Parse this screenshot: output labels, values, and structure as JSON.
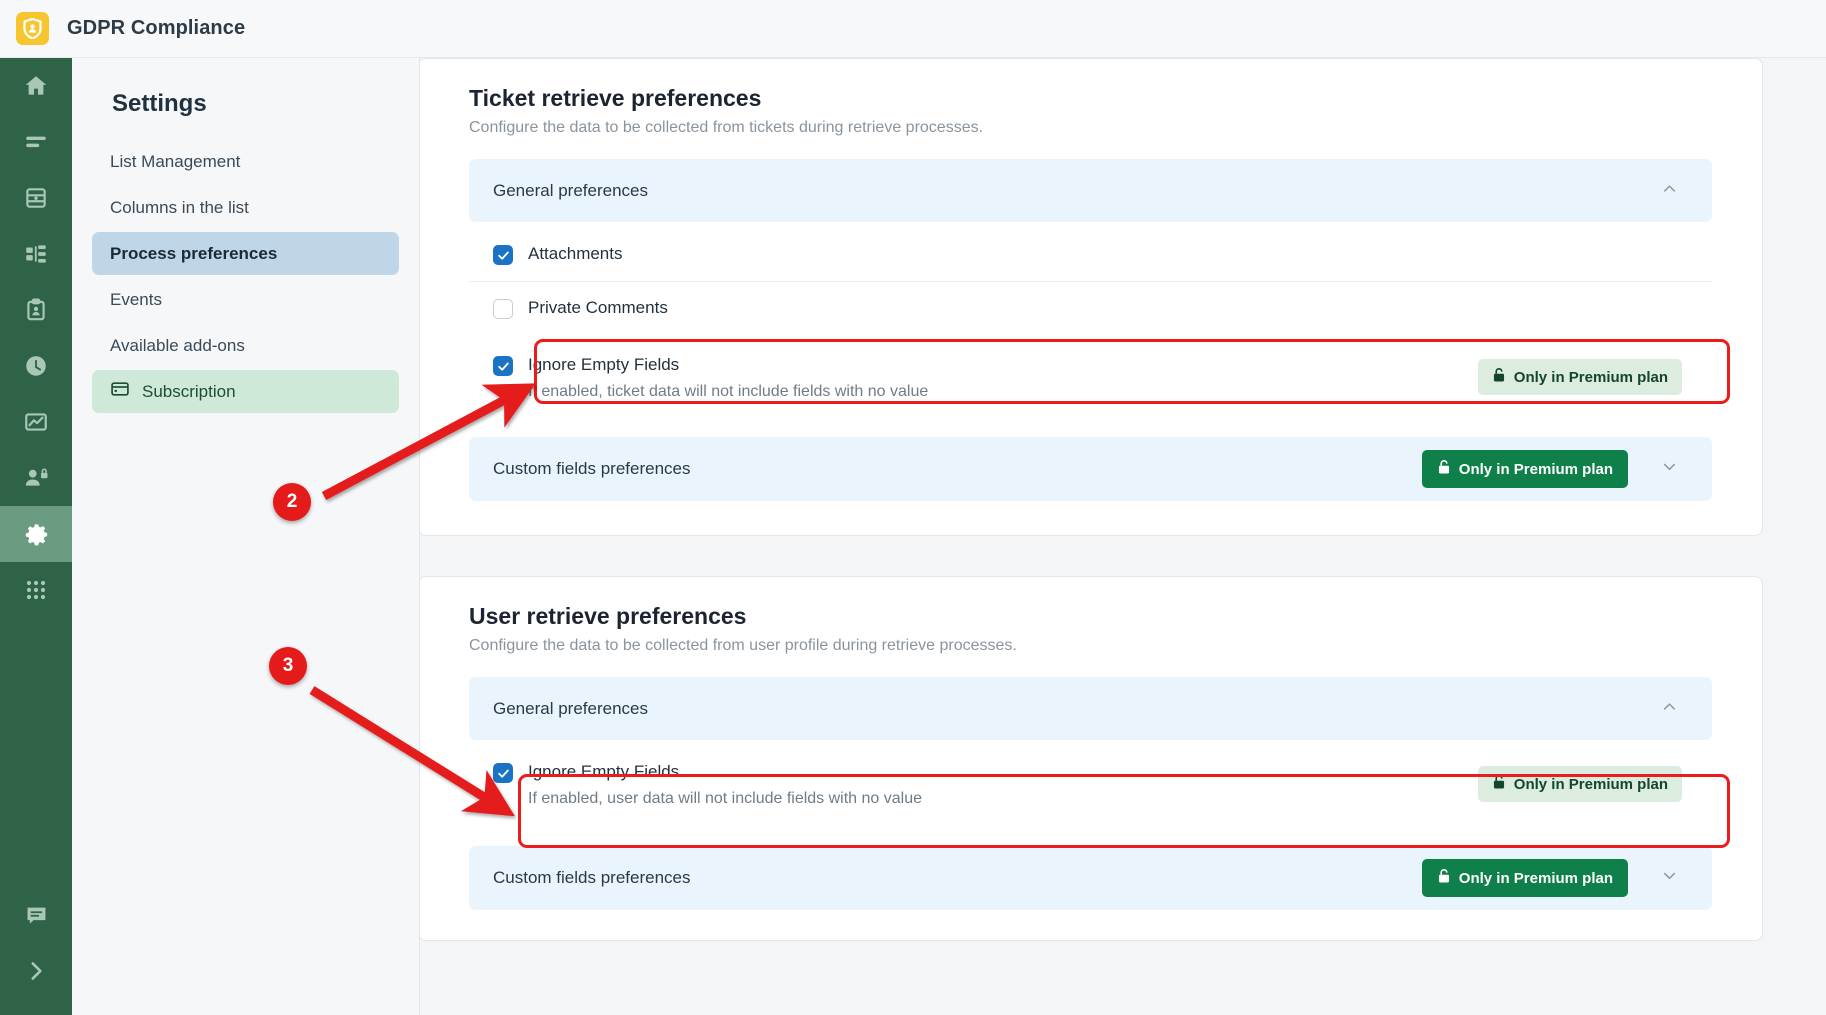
{
  "window": {
    "app_title": "GDPR Compliance",
    "logo_icon": "shield-user-icon"
  },
  "rail": {
    "items": [
      {
        "icon": "home-icon",
        "name": "home",
        "active": false
      },
      {
        "icon": "list-icon",
        "name": "lists",
        "active": false
      },
      {
        "icon": "database-icon",
        "name": "database",
        "active": false
      },
      {
        "icon": "org-chart-icon",
        "name": "organization",
        "active": false
      },
      {
        "icon": "clipboard-user-icon",
        "name": "requests",
        "active": false
      },
      {
        "icon": "clock-icon",
        "name": "history",
        "active": false
      },
      {
        "icon": "chart-line-icon",
        "name": "reports",
        "active": false
      },
      {
        "icon": "user-lock-icon",
        "name": "privacy",
        "active": false
      },
      {
        "icon": "gear-icon",
        "name": "settings",
        "active": true
      },
      {
        "icon": "grid-apps-icon",
        "name": "apps",
        "active": false
      }
    ],
    "bottom_items": [
      {
        "icon": "comment-icon",
        "name": "support-chat"
      },
      {
        "icon": "chevron-right-icon",
        "name": "expand-rail"
      }
    ]
  },
  "sidebar": {
    "title": "Settings",
    "items": [
      {
        "label": "List Management",
        "active": false,
        "icon": null
      },
      {
        "label": "Columns in the list",
        "active": false,
        "icon": null
      },
      {
        "label": "Process preferences",
        "active": true,
        "icon": null
      },
      {
        "label": "Events",
        "active": false,
        "icon": null
      },
      {
        "label": "Available add-ons",
        "active": false,
        "icon": null
      },
      {
        "label": "Subscription",
        "active": false,
        "icon": "credit-card-icon"
      }
    ]
  },
  "ticket_section": {
    "title": "Ticket retrieve preferences",
    "subtitle": "Configure the data to be collected from tickets during retrieve processes.",
    "general": {
      "label": "General preferences",
      "chevron": "chevron-up-icon",
      "rows": [
        {
          "label": "Attachments",
          "checked": true,
          "desc": null,
          "badge": null
        },
        {
          "label": "Private Comments",
          "checked": false,
          "desc": null,
          "badge": null
        },
        {
          "label": "Ignore Empty Fields",
          "checked": true,
          "desc": "If enabled, ticket data will not include fields with no value",
          "badge": "Only in Premium plan",
          "badge_style": "soft",
          "badge_icon": "unlock-icon"
        }
      ]
    },
    "custom_fields": {
      "label": "Custom fields preferences",
      "badge": "Only in Premium plan",
      "badge_style": "solid",
      "badge_icon": "unlock-icon",
      "chevron": "chevron-down-icon"
    }
  },
  "user_section": {
    "title": "User retrieve preferences",
    "subtitle": "Configure the data to be collected from user profile during retrieve processes.",
    "general": {
      "label": "General preferences",
      "chevron": "chevron-up-icon",
      "rows": [
        {
          "label": "Ignore Empty Fields",
          "checked": true,
          "desc": "If enabled, user data will not include fields with no value",
          "badge": "Only in Premium plan",
          "badge_style": "soft",
          "badge_icon": "unlock-icon"
        }
      ]
    },
    "custom_fields": {
      "label": "Custom fields preferences",
      "badge": "Only in Premium plan",
      "badge_style": "solid",
      "badge_icon": "unlock-icon",
      "chevron": "chevron-down-icon"
    }
  },
  "annotations": {
    "markers": [
      {
        "number": "2",
        "target": "ticket-ignore-empty-fields-row"
      },
      {
        "number": "3",
        "target": "user-ignore-empty-fields-row"
      }
    ],
    "highlight_color": "#ee1b1b"
  },
  "colors": {
    "rail_bg": "#2e6348",
    "rail_active": "#6b9b81",
    "accent_blue": "#1a73c4",
    "band_bg": "#eaf4fd",
    "nav_active": "#bfd6e8",
    "subscription_bg": "#cfe9d8",
    "premium_solid": "#0f8049",
    "premium_soft": "#dcecdf",
    "annotation_red": "#e51b1b"
  }
}
